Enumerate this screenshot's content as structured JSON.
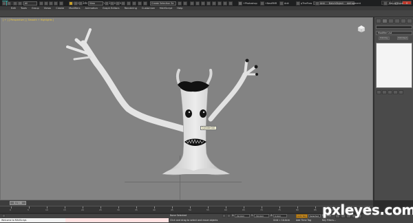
{
  "window": {
    "title": "Autodesk 3ds Max Design 2014   Untitled",
    "search_placeholder": "Type a keyword or phrase",
    "minimize": "–",
    "maximize": "□",
    "close": "✕"
  },
  "menubar": [
    "Edit",
    "Tools",
    "Group",
    "Views",
    "Create",
    "Modifiers",
    "Animation",
    "Graph Editors",
    "Rendering",
    "Customize",
    "MAXScript",
    "Help"
  ],
  "toolbar": {
    "filter_value": "All",
    "refcoord_value": "View",
    "selection_set_placeholder": "Create Selection Se",
    "right_items": [
      "+Photoshop",
      "+NeoRMR",
      "Anit",
      "qTheFlow",
      "Anti",
      "BatchObject",
      "defragment",
      "RenderMask"
    ]
  },
  "viewport": {
    "label": "[ + ] [ Perspective ] [ Smooth + Highlights ]",
    "tooltip": "Cylinder001"
  },
  "command_panel": {
    "modifier_list": "Modifier List",
    "stack_buttons": [
      "Edit Poly",
      "Edit Mesh"
    ]
  },
  "timeline": {
    "slider_value": "0 / 100",
    "ticks": [
      "0",
      "5",
      "10",
      "15",
      "20",
      "25",
      "30",
      "35",
      "40",
      "45",
      "50",
      "55",
      "60",
      "65",
      "70",
      "75",
      "80",
      "85",
      "90",
      "95",
      "100"
    ]
  },
  "status": {
    "maxscript": "Welcome to MAXScript.",
    "selection": "None Selected",
    "prompt": "Click and drag to select and move objects",
    "x_label": "X:",
    "x_value": "-50.0cm",
    "y_label": "Y:",
    "y_value": "-59.0cm",
    "z_label": "Z:",
    "z_value": "0.0cm",
    "grid": "Grid = 10.0cm",
    "add_time_tag": "Add Time Tag",
    "auto_key": "Auto Key",
    "selected": "Selected",
    "set_key": "Set Key",
    "key_filters": "Key Filters..."
  },
  "watermark": "pxleyes.com",
  "colors": {
    "viewport_bg": "#838383",
    "active_viewport_border": "#f0c93a",
    "auto_key": "#c4881f",
    "maxscript_bg": "#f2f2f2"
  }
}
